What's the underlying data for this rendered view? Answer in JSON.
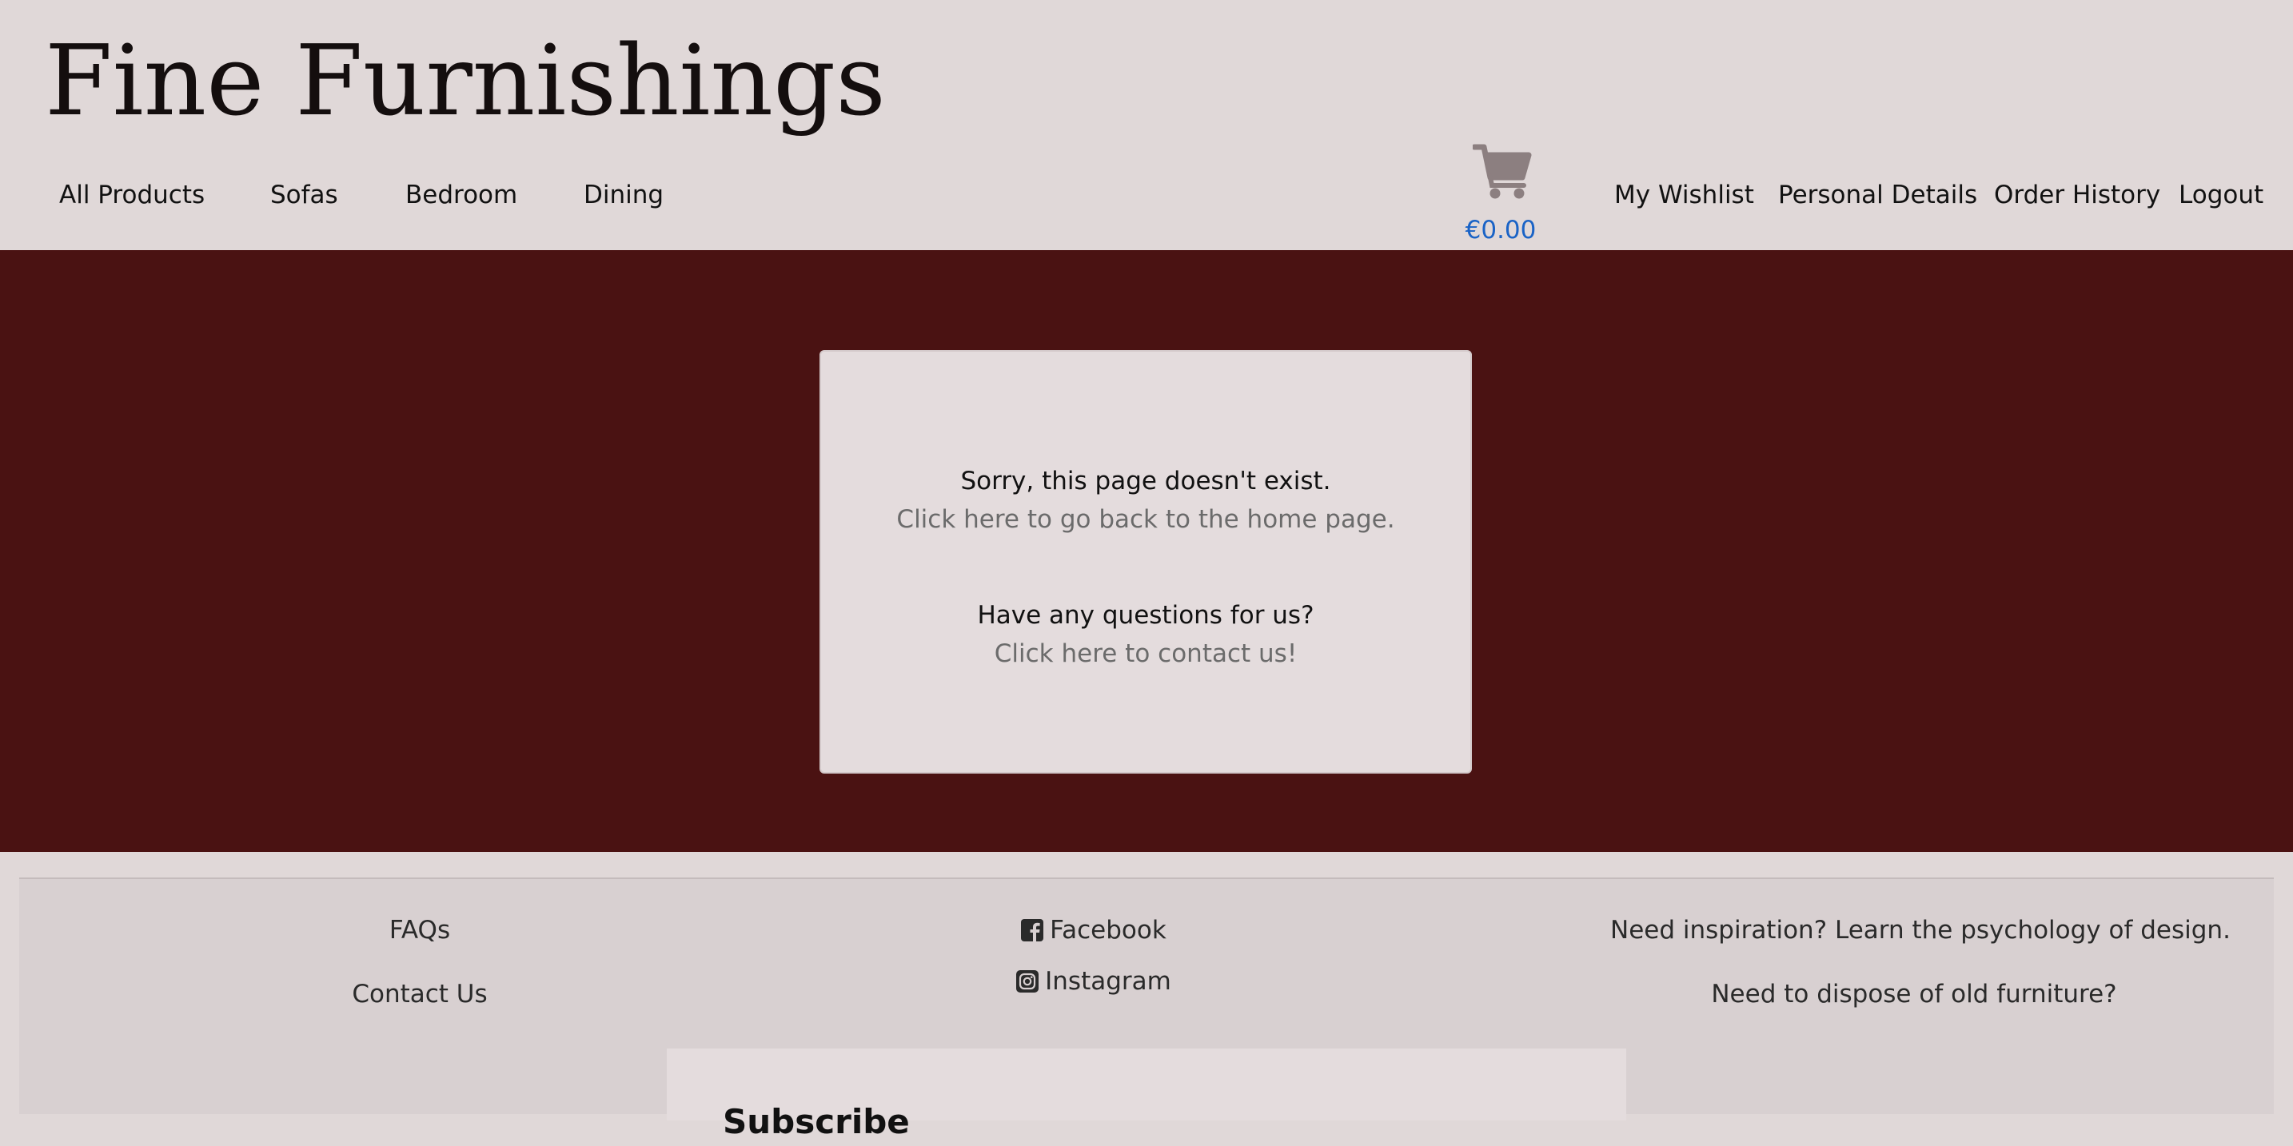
{
  "brand": {
    "name": "Fine Furnishings"
  },
  "nav": {
    "left": [
      "All Products",
      "Sofas",
      "Bedroom",
      "Dining"
    ],
    "right": [
      "My Wishlist",
      "Personal Details",
      "Order History",
      "Logout"
    ]
  },
  "cart": {
    "icon": "shopping-cart-icon",
    "total": "€0.00"
  },
  "colors": {
    "hero_bg": "#4a1212",
    "header_bg": "#e0d8d8",
    "cart_total": "#1a63c6"
  },
  "error_card": {
    "message": "Sorry, this page doesn't exist.",
    "home_link": "Click here to go back to the home page.",
    "question": "Have any questions for us?",
    "contact_link": "Click here to contact us!"
  },
  "footer": {
    "faqs": "FAQs",
    "contact": "Contact Us",
    "facebook": "Facebook",
    "instagram": "Instagram",
    "inspiration": "Need inspiration? Learn the psychology of design.",
    "dispose": "Need to dispose of old furniture?",
    "subscribe_title": "Subscribe"
  }
}
